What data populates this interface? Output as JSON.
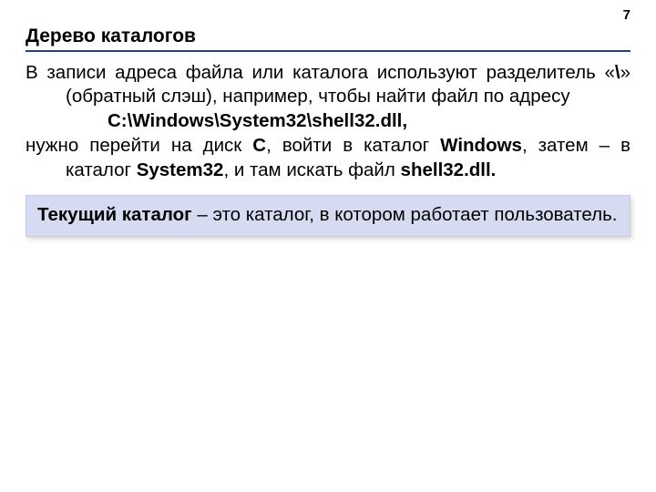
{
  "page_number": "7",
  "title": "Дерево каталогов",
  "p1_a": "В записи адреса файла или каталога используют разделитель «",
  "p1_slash": "\\",
  "p1_b": "» (обратный слэш), например, чтобы найти файл по адресу",
  "path": "C:\\Windows\\System32\\shell32.dll,",
  "p2_a": "нужно перейти на диск ",
  "p2_C": "C",
  "p2_b": ", войти в каталог ",
  "p2_Win": "Windows",
  "p2_c": ", затем – в каталог ",
  "p2_Sys": "System32",
  "p2_d": ", и там искать файл ",
  "p2_shell": "shell32.dll.",
  "callout_term": "Текущий каталог",
  "callout_rest": " – это каталог, в котором работает пользователь."
}
